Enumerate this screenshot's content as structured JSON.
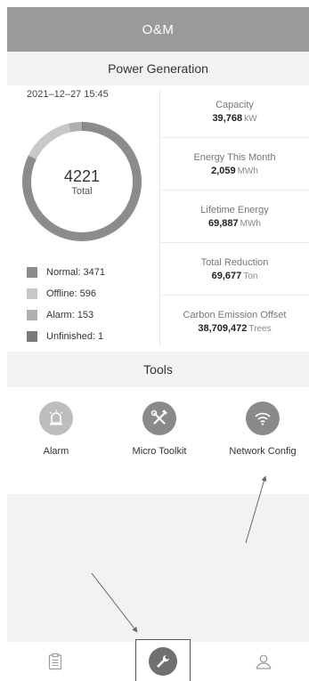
{
  "header": {
    "title": "O&M"
  },
  "power_generation": {
    "title": "Power Generation",
    "timestamp": "2021–12–27 15:45",
    "total_value": "4221",
    "total_label": "Total",
    "legend": [
      {
        "label": "Normal:",
        "value": "3471",
        "color": "#8c8c8c"
      },
      {
        "label": "Offline:",
        "value": "596",
        "color": "#c8c8c8"
      },
      {
        "label": "Alarm:",
        "value": "153",
        "color": "#b0b0b0"
      },
      {
        "label": "Unfinished:",
        "value": "1",
        "color": "#7a7a7a"
      }
    ],
    "stats": [
      {
        "label": "Capacity",
        "value": "39,768",
        "unit": "kW"
      },
      {
        "label": "Energy This Month",
        "value": "2,059",
        "unit": "MWh"
      },
      {
        "label": "Lifetime Energy",
        "value": "69,887",
        "unit": "MWh"
      },
      {
        "label": "Total Reduction",
        "value": "69,677",
        "unit": "Ton"
      },
      {
        "label": "Carbon Emission Offset",
        "value": "38,709,472",
        "unit": "Trees"
      }
    ]
  },
  "tools": {
    "title": "Tools",
    "items": [
      {
        "label": "Alarm",
        "icon": "alarm-light-icon"
      },
      {
        "label": "Micro Toolkit",
        "icon": "tools-icon"
      },
      {
        "label": "Network Config",
        "icon": "wifi-icon"
      }
    ]
  },
  "nav": {
    "items": [
      {
        "icon": "clipboard-icon"
      },
      {
        "icon": "wrench-icon",
        "active": true
      },
      {
        "icon": "user-icon"
      }
    ]
  },
  "colors": {
    "header_bg": "#9a9a9a",
    "donut_normal": "#8c8c8c",
    "donut_offline": "#c8c8c8",
    "donut_alarm": "#b0b0b0",
    "donut_unfinished": "#7a7a7a",
    "tool_icon_bg": "#bdbdbd",
    "tool_icon_dark_bg": "#8a8a8a"
  }
}
